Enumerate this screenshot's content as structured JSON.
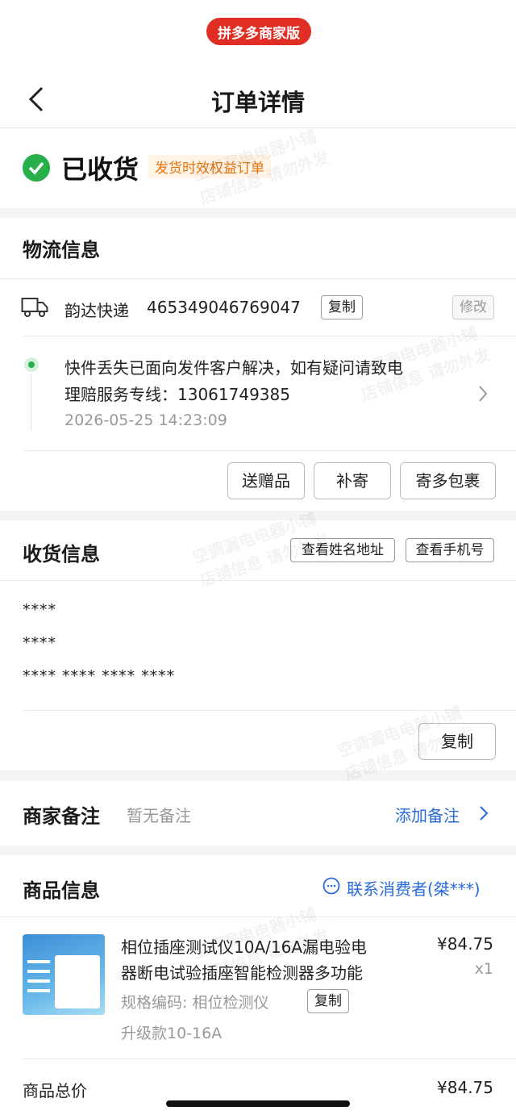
{
  "brand": "拼多多商家版",
  "page_title": "订单详情",
  "status": {
    "text": "已收货",
    "tag": "发货时效权益订单"
  },
  "logistics": {
    "title": "物流信息",
    "courier": "韵达快递",
    "tracking_number": "465349046769047",
    "copy_label": "复制",
    "modify_label": "修改",
    "latest_line1": "快件丢失已面向发件客户解决，如有疑问请致电",
    "latest_line2": "理赔服务专线：13061749385",
    "latest_time": "2026-05-25 14:23:09",
    "actions": [
      "送赠品",
      "补寄",
      "寄多包裹"
    ]
  },
  "receiver": {
    "title": "收货信息",
    "view_name_addr": "查看姓名地址",
    "view_phone": "查看手机号",
    "line1": "****",
    "line2": "****",
    "line3": "**** **** **** ****",
    "copy_label": "复制"
  },
  "note": {
    "title": "商家备注",
    "empty": "暂无备注",
    "add": "添加备注"
  },
  "goods": {
    "title": "商品信息",
    "contact": "联系消费者(桀***)",
    "name_line1": "相位插座测试仪10A/16A漏电验电",
    "name_line2": "器断电试验插座智能检测器多功能",
    "price": "¥84.75",
    "qty": "x1",
    "spec": "规格编码: 相位检测仪",
    "spec_copy": "复制",
    "variant": "升级款10-16A",
    "total_label": "商品总价",
    "total_value": "¥84.75"
  },
  "watermark": {
    "line1": "空调漏电电器小铺",
    "line2": "店铺信息 请勿外发"
  },
  "colors": {
    "brand_red": "#e02e24",
    "status_green": "#27b04a",
    "link_blue": "#2a6ad8",
    "tag_orange": "#e8730c"
  }
}
